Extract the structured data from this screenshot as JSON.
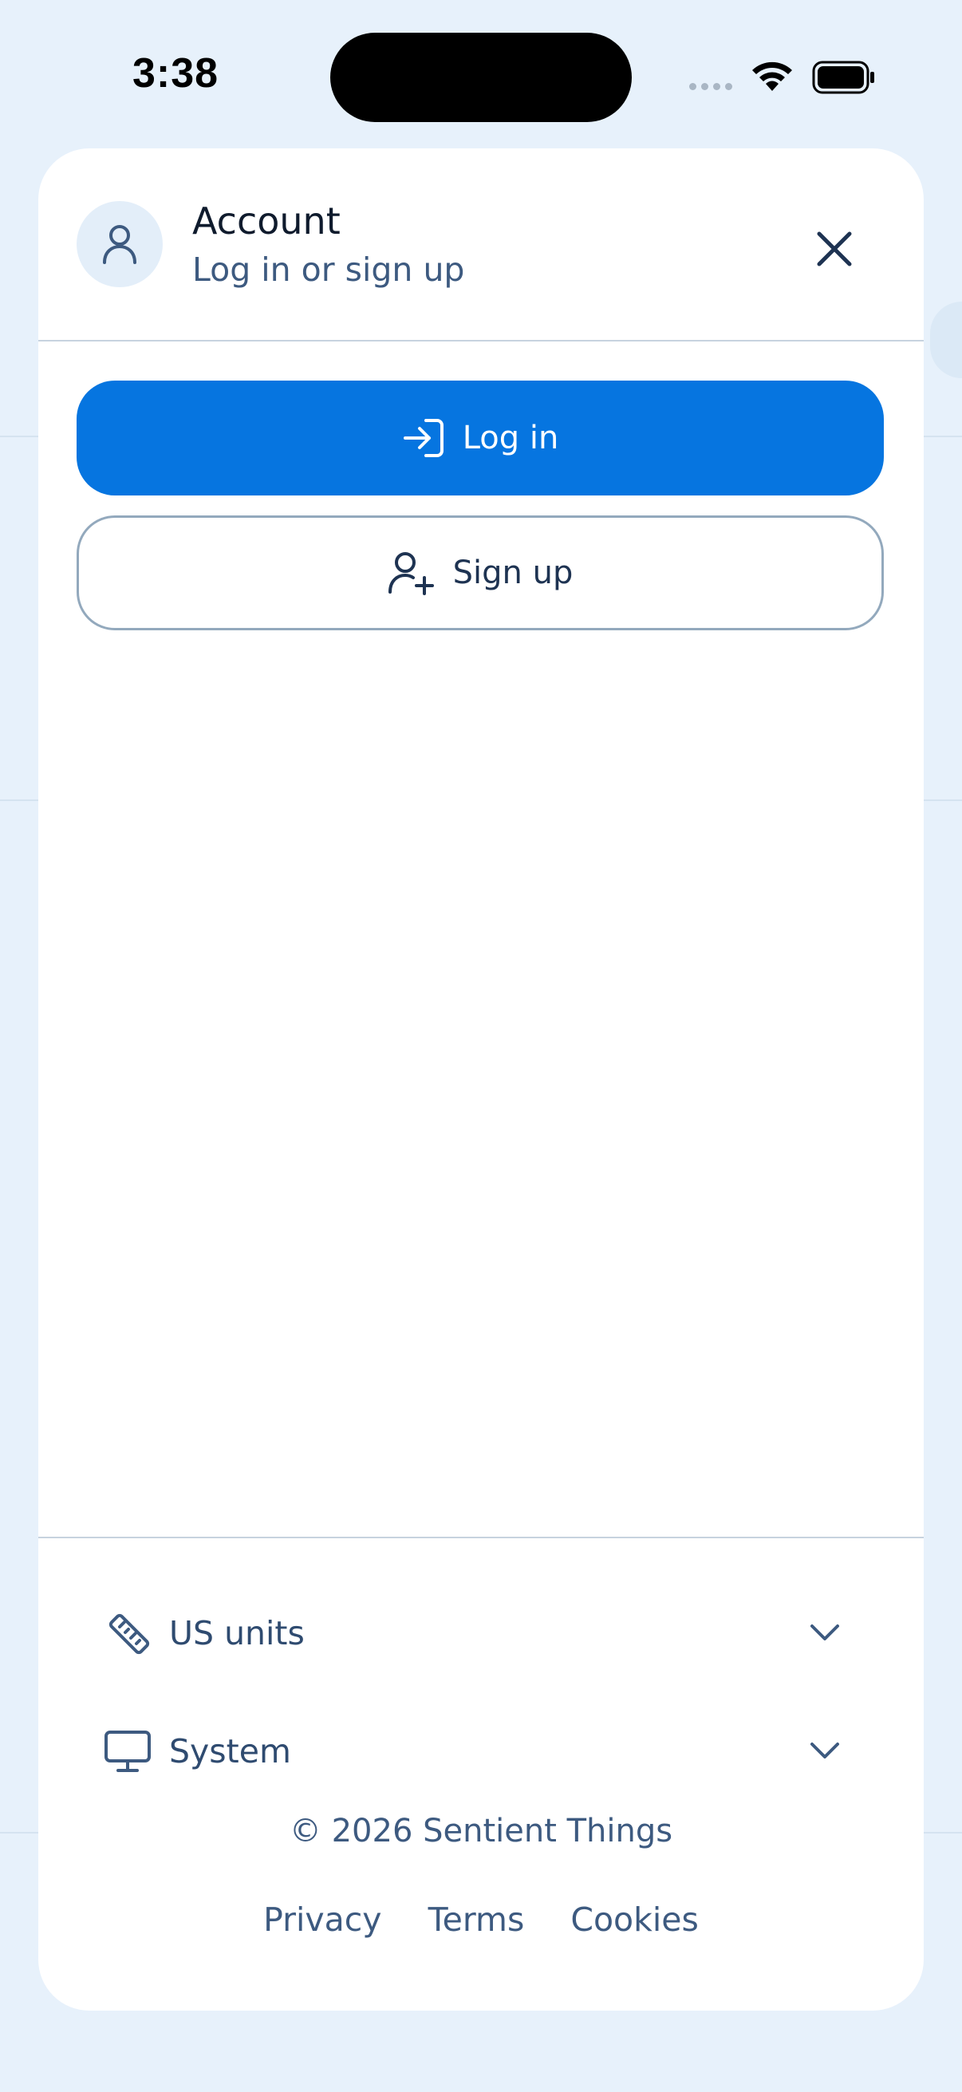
{
  "status_bar": {
    "time": "3:38"
  },
  "account": {
    "title": "Account",
    "subtitle": "Log in or sign up"
  },
  "buttons": {
    "login": "Log in",
    "signup": "Sign up"
  },
  "settings": [
    {
      "label": "US units",
      "icon": "ruler-icon"
    },
    {
      "label": "System",
      "icon": "monitor-icon"
    }
  ],
  "footer": {
    "copyright": "© 2026 Sentient Things",
    "links": [
      "Privacy",
      "Terms",
      "Cookies"
    ]
  },
  "colors": {
    "primary": "#0675e0",
    "text": "#3d5a80",
    "background": "#e7f1fb"
  }
}
